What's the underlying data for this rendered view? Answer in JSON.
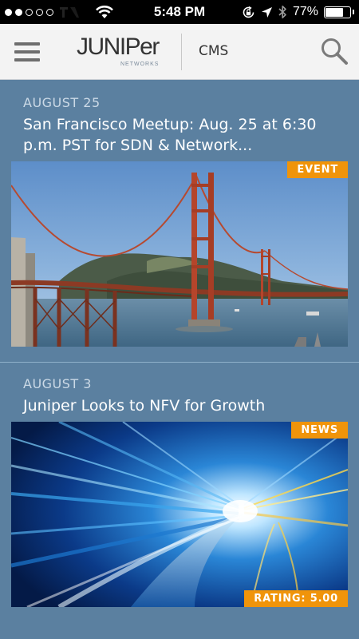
{
  "status_bar": {
    "time": "5:48 PM",
    "battery_percent": "77%",
    "battery_level": 0.77,
    "signal_bars_filled": 2,
    "signal_bars_total": 5
  },
  "header": {
    "logo_text": "JUNIPer",
    "logo_subtext": "NETWORKS",
    "section_label": "CMS"
  },
  "feed": {
    "items": [
      {
        "date": "AUGUST 25",
        "title": "San Francisco Meetup: Aug. 25 at 6:30 p.m. PST for SDN & Network...",
        "badge": "EVENT"
      },
      {
        "date": "AUGUST 3",
        "title": "Juniper Looks to NFV for Growth",
        "badge": "NEWS",
        "rating": "RATING: 5.00"
      }
    ]
  },
  "colors": {
    "background": "#5b80a0",
    "header_bg": "#f3f3f3",
    "badge": "#f0940a"
  }
}
